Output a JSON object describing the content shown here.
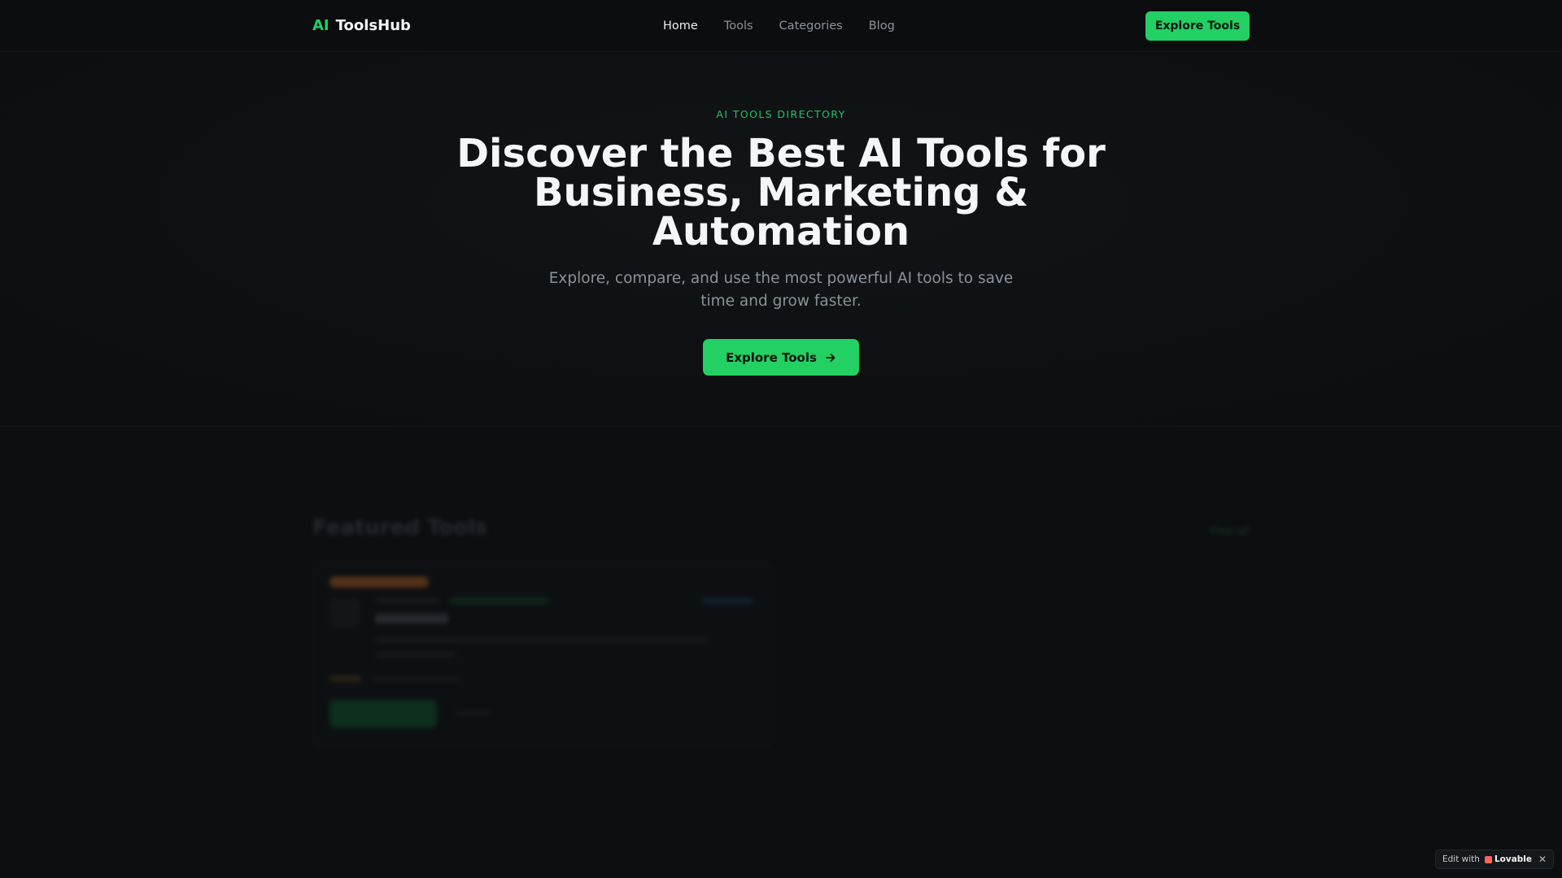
{
  "header": {
    "logo_ai": "AI",
    "logo_name": "ToolsHub",
    "nav": [
      "Home",
      "Tools",
      "Categories",
      "Blog"
    ],
    "cta_label": "Explore Tools"
  },
  "hero": {
    "eyebrow": "AI TOOLS DIRECTORY",
    "title": "Discover the Best AI Tools for Business, Marketing & Automation",
    "subtitle": "Explore, compare, and use the most powerful AI tools to save time and grow faster.",
    "cta_label": "Explore Tools"
  },
  "featured": {
    "title": "Featured Tools",
    "view_all": "View all",
    "card_name": "Copy.ai"
  },
  "lovable": {
    "edit_label": "Edit with",
    "brand": "Lovable"
  },
  "colors": {
    "accent": "#22d063",
    "background": "#0c0e10"
  }
}
